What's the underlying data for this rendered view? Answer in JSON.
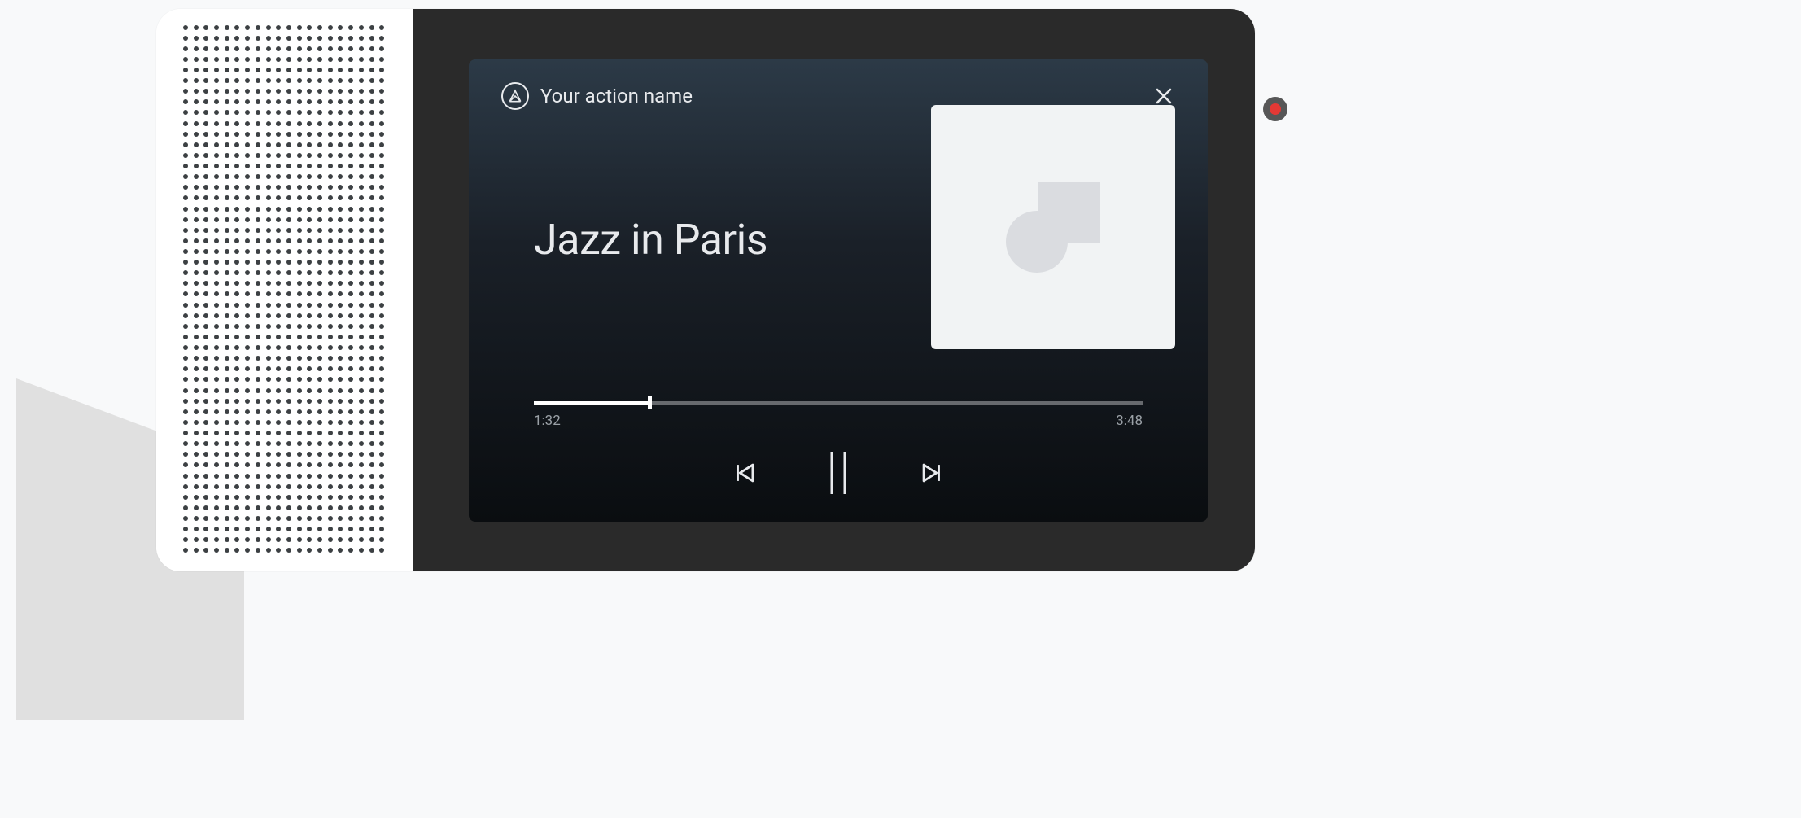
{
  "header": {
    "action_name": "Your action name"
  },
  "media": {
    "track_title": "Jazz in Paris",
    "elapsed": "1:32",
    "duration": "3:48",
    "progress_percent": 19
  },
  "icons": {
    "close": "close-icon",
    "previous": "skip-previous-icon",
    "pause": "pause-icon",
    "next": "skip-next-icon",
    "logo": "app-logo-icon",
    "record": "record-indicator"
  }
}
